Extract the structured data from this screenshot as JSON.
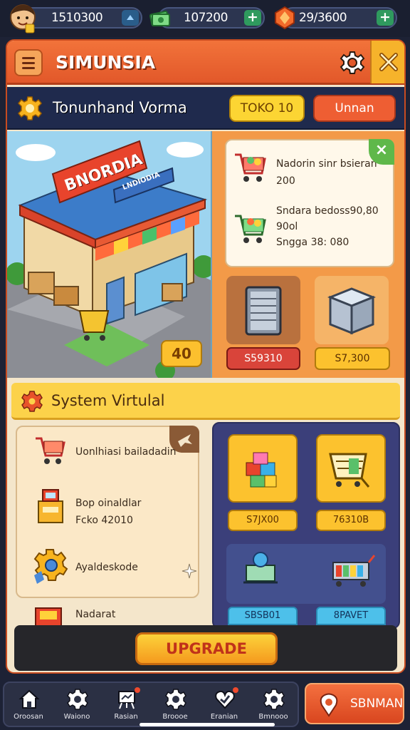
{
  "resources": [
    {
      "icon": "player-avatar-icon",
      "value": "1510300"
    },
    {
      "icon": "cash-stack-icon",
      "value": "107200"
    },
    {
      "icon": "gem-icon",
      "value": "29/3600"
    }
  ],
  "header": {
    "title": "SIMUNSIA"
  },
  "store_bar": {
    "title": "Tonunhand Vorma",
    "button_primary": "TOKO 10",
    "button_secondary": "Unnan"
  },
  "store": {
    "sign": "BNORDIA",
    "subsign": "LNDIODIA",
    "level": "40"
  },
  "offer": {
    "line1": "Nadorin sinr bsieran",
    "line2": "200",
    "line3": "Sndara bedoss90,80",
    "line4": "90ol",
    "line5": "Sngga 38: 080"
  },
  "equipment": [
    {
      "icon": "fridge-icon",
      "price": "S59310"
    },
    {
      "icon": "freezer-box-icon",
      "price": "S7,300"
    }
  ],
  "system": {
    "title": "System Virtulal"
  },
  "list": [
    {
      "icon": "cart-icon",
      "lines": [
        "Uonlhiasi bailadadin"
      ]
    },
    {
      "icon": "cash-register-icon",
      "lines": [
        "Bop oinaldlar",
        "Fcko 42010"
      ]
    },
    {
      "icon": "gear-badge-icon",
      "lines": [
        "Ayaldeskode"
      ]
    },
    {
      "icon": "grocery-box-icon",
      "lines": [
        "Nadarat"
      ]
    }
  ],
  "grid": [
    {
      "icon": "goods-stack-icon",
      "price": "S7JX00"
    },
    {
      "icon": "trolley-icon",
      "price": "76310B"
    },
    {
      "icon": "computer-icon",
      "price": "SBSB01"
    },
    {
      "icon": "shelf-cart-icon",
      "price": "8PAVET"
    }
  ],
  "upgrade": {
    "label": "UPGRADE"
  },
  "nav": [
    {
      "icon": "home-icon",
      "label": "Oroosan"
    },
    {
      "icon": "gear-icon",
      "label": "Waiono"
    },
    {
      "icon": "easel-icon",
      "label": "Rasian"
    },
    {
      "icon": "gear-icon",
      "label": "Broooe"
    },
    {
      "icon": "heart-check-icon",
      "label": "Eranian"
    },
    {
      "icon": "gear-icon",
      "label": "Bmnooo"
    }
  ],
  "action": {
    "icon": "location-pin-icon",
    "label": "SBNMAN"
  },
  "colors": {
    "accent_orange": "#e8622f",
    "accent_yellow": "#fcd24a",
    "panel_navy": "#1f2a4d",
    "plus_green": "#2f9a5e"
  }
}
